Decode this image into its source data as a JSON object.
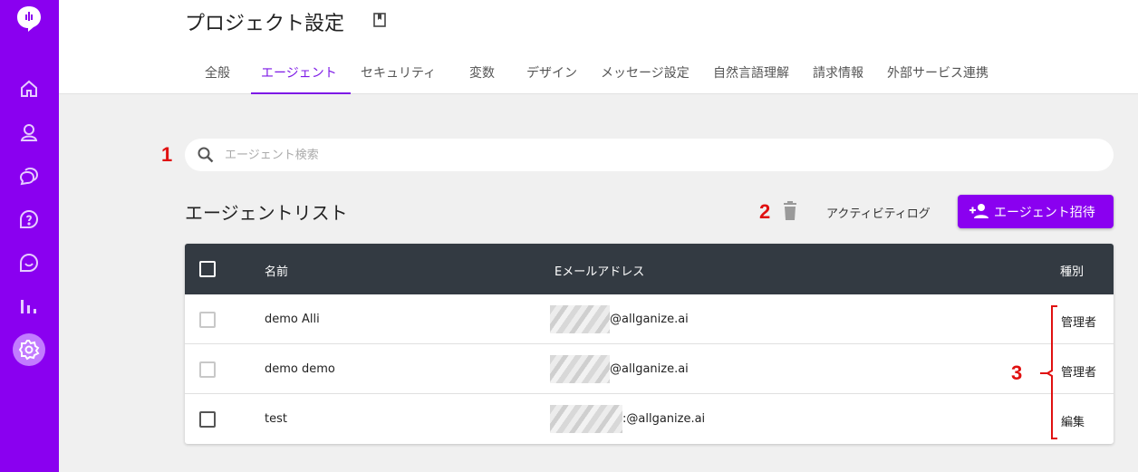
{
  "page": {
    "title": "プロジェクト設定"
  },
  "tabs": [
    {
      "label": "全般"
    },
    {
      "label": "エージェント"
    },
    {
      "label": "セキュリティ"
    },
    {
      "label": "変数"
    },
    {
      "label": "デザイン"
    },
    {
      "label": "メッセージ設定"
    },
    {
      "label": "自然言語理解"
    },
    {
      "label": "請求情報"
    },
    {
      "label": "外部サービス連携"
    }
  ],
  "search": {
    "placeholder": "エージェント検索",
    "value": ""
  },
  "section": {
    "title": "エージェントリスト"
  },
  "toolbar": {
    "activity_log": "アクティビティログ",
    "invite_label": "エージェント招待"
  },
  "table": {
    "headers": {
      "name": "名前",
      "email": "Eメールアドレス",
      "role": "種別"
    },
    "rows": [
      {
        "name": "demo Alli",
        "email": "@allganize.ai",
        "role": "管理者"
      },
      {
        "name": "demo demo",
        "email": "@allganize.ai",
        "role": "管理者"
      },
      {
        "name": "test",
        "email": ":@allganize.ai",
        "role": "編集"
      }
    ]
  },
  "callouts": [
    "1",
    "2",
    "3"
  ],
  "colors": {
    "sidebar": "#8a00f0",
    "accent": "#7d19e6",
    "table_header": "#333a42",
    "callout": "#e01010"
  },
  "icons": [
    "logo-icon",
    "home-icon",
    "user-icon",
    "chat-icon",
    "help-icon",
    "message-icon",
    "stats-icon",
    "settings-icon",
    "bookmark-icon",
    "search-icon",
    "trash-icon",
    "add-user-icon"
  ]
}
